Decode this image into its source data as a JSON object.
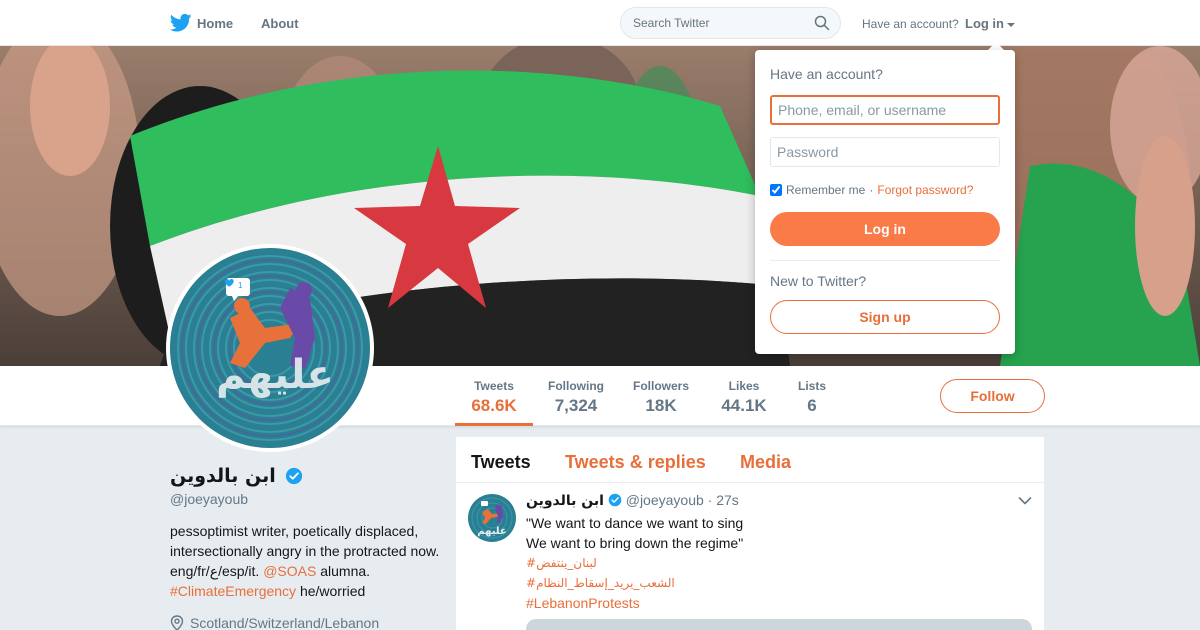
{
  "nav": {
    "home_label": "Home",
    "about_label": "About",
    "search_placeholder": "Search Twitter",
    "have_account_text": "Have an account?",
    "login_label": "Log in"
  },
  "profile": {
    "name": "ابن بالدوين",
    "handle": "@joeyayoub",
    "bio_parts": {
      "text1": "pessoptimist writer, poetically displaced, intersectionally angry in the protracted now. eng/fr/ع/esp/it. ",
      "mention": "@SOAS",
      "text2": " alumna. ",
      "hashtag": "#ClimateEmergency",
      "text3": " he/worried"
    },
    "location": "Scotland/Switzerland/Lebanon",
    "avatar_overlay": "عليهم",
    "avatar_badge": "1"
  },
  "stats": [
    {
      "label": "Tweets",
      "value": "68.6K"
    },
    {
      "label": "Following",
      "value": "7,324"
    },
    {
      "label": "Followers",
      "value": "18K"
    },
    {
      "label": "Likes",
      "value": "44.1K"
    },
    {
      "label": "Lists",
      "value": "6"
    }
  ],
  "follow_label": "Follow",
  "timeline": {
    "tabs": [
      "Tweets",
      "Tweets & replies",
      "Media"
    ],
    "tweet": {
      "name": "ابن بالدوين",
      "handle": "@joeyayoub",
      "time": "· 27s",
      "line1": "\"We want to dance we want to sing",
      "line2": "We want to bring down the regime\"",
      "tag1": "#لبنان_ينتفض",
      "tag2": "#الشعب_يريد_إسقاط_النظام",
      "tag3": "#LebanonProtests"
    }
  },
  "login_dropdown": {
    "title": "Have an account?",
    "username_placeholder": "Phone, email, or username",
    "password_placeholder": "Password",
    "remember_label": "Remember me",
    "separator": "·",
    "forgot_label": "Forgot password?",
    "login_button": "Log in",
    "new_text": "New to Twitter?",
    "signup_button": "Sign up"
  },
  "colors": {
    "accent": "#e86f3a",
    "twitter_blue": "#1da1f2"
  }
}
